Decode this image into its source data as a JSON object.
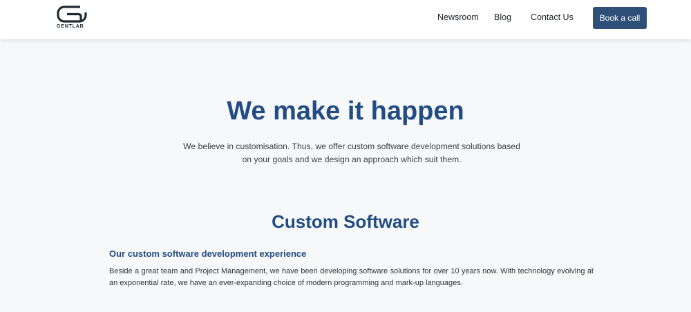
{
  "header": {
    "logo_text": "GENTLAB",
    "nav": {
      "newsroom": "Newsroom",
      "blog": "Blog",
      "contact": "Contact Us"
    },
    "cta_label": "Book a call"
  },
  "hero": {
    "title": "We make it happen",
    "subtitle": "We believe in customisation. Thus, we offer custom software development solutions based on your goals and we design an approach which suit them."
  },
  "section": {
    "title": "Custom Software",
    "subheading": "Our custom software development experience",
    "body": "Beside a great team and Project Management, we have been developing software solutions for over 10 years now. With technology evolving at an exponential rate, we have an ever-expanding choice of modern programming and mark-up languages."
  },
  "colors": {
    "brand": "#224c82",
    "cta_background": "#2e4f78",
    "page_background": "#f6f8fa",
    "header_background": "#ffffff"
  },
  "icons": {
    "logo": "gentlab-logo-icon"
  }
}
